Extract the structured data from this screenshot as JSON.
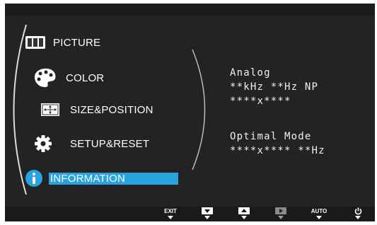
{
  "menu": {
    "items": [
      {
        "label": "PICTURE"
      },
      {
        "label": "COLOR"
      },
      {
        "label": "SIZE&POSITION"
      },
      {
        "label": "SETUP&RESET"
      },
      {
        "label": "INFORMATION"
      }
    ],
    "selected_index": 4
  },
  "info": {
    "line1": "Analog",
    "line2": "**kHz **Hz NP",
    "line3": "****x****",
    "line4": "Optimal Mode",
    "line5": "****x****  **Hz"
  },
  "bottom_buttons": {
    "exit": "EXIT",
    "auto": "AUTO"
  },
  "colors": {
    "highlight": "#29a3de",
    "background": "#232323"
  }
}
